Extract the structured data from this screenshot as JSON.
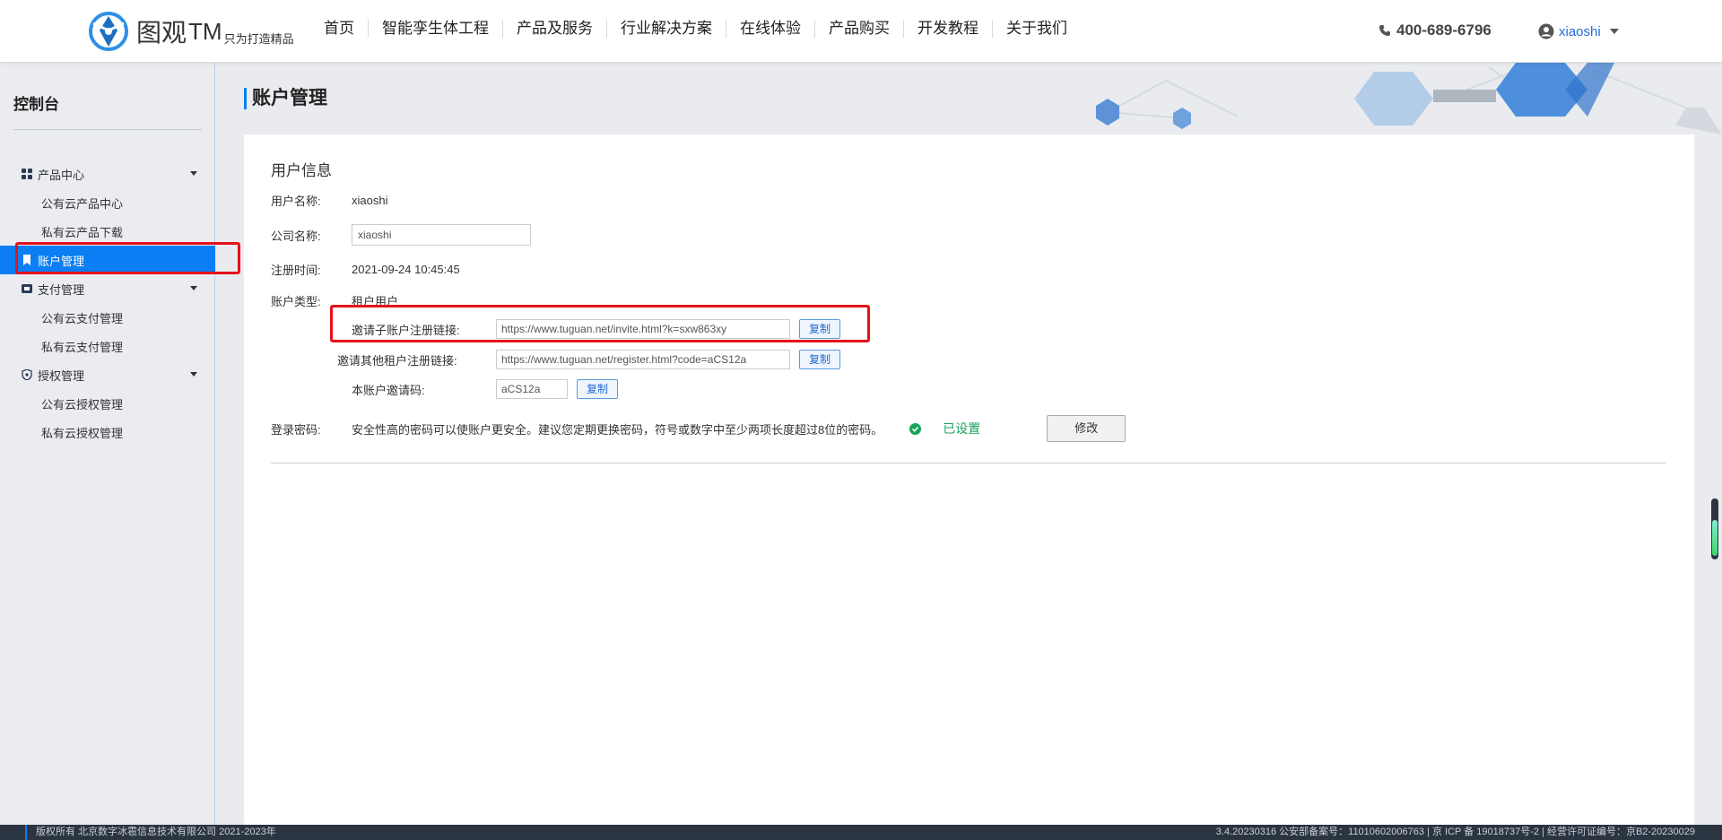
{
  "header": {
    "logo_text": "图观",
    "logo_tm": "TM",
    "logo_slogan": "只为打造精品",
    "nav": [
      "首页",
      "智能孪生体工程",
      "产品及服务",
      "行业解决方案",
      "在线体验",
      "产品购买",
      "开发教程",
      "关于我们"
    ],
    "phone": "400-689-6796",
    "username": "xiaoshi"
  },
  "sidebar": {
    "title": "控制台",
    "groups": [
      {
        "label": "产品中心",
        "icon": "grid-icon",
        "items": [
          "公有云产品中心",
          "私有云产品下载"
        ]
      },
      {
        "label": "账户管理",
        "icon": "bookmark-icon",
        "active": true
      },
      {
        "label": "支付管理",
        "icon": "ticket-icon",
        "items": [
          "公有云支付管理",
          "私有云支付管理"
        ]
      },
      {
        "label": "授权管理",
        "icon": "shield-icon",
        "items": [
          "公有云授权管理",
          "私有云授权管理"
        ]
      }
    ]
  },
  "page": {
    "title": "账户管理"
  },
  "user_info": {
    "section_title": "用户信息",
    "username_label": "用户名称:",
    "username_value": "xiaoshi",
    "company_label": "公司名称:",
    "company_value": "xiaoshi",
    "register_label": "注册时间:",
    "register_value": "2021-09-24 10:45:45",
    "account_type_label": "账户类型:",
    "account_type_value": "租户用户",
    "invite_sub_label": "邀请子账户注册链接:",
    "invite_sub_value": "https://www.tuguan.net/invite.html?k=sxw863xy",
    "invite_tenant_label": "邀请其他租户注册链接:",
    "invite_tenant_value": "https://www.tuguan.net/register.html?code=aCS12a",
    "invite_code_label": "本账户邀请码:",
    "invite_code_value": "aCS12a",
    "copy_label": "复制",
    "password_label": "登录密码:",
    "password_desc": "安全性高的密码可以使账户更安全。建议您定期更换密码，符号或数字中至少两项长度超过8位的密码。",
    "password_status": "已设置",
    "modify_label": "修改"
  },
  "footer": {
    "left": "版权所有 北京数字冰雹信息技术有限公司 2021-2023年",
    "right": "3.4.20230316 公安部备案号：11010602006763 | 京 ICP 备 19018737号-2 | 经营许可证编号：京B2-20230029"
  },
  "colors": {
    "accent": "#0a7ef2",
    "highlight": "#e5121a",
    "success": "#1aa35b"
  }
}
